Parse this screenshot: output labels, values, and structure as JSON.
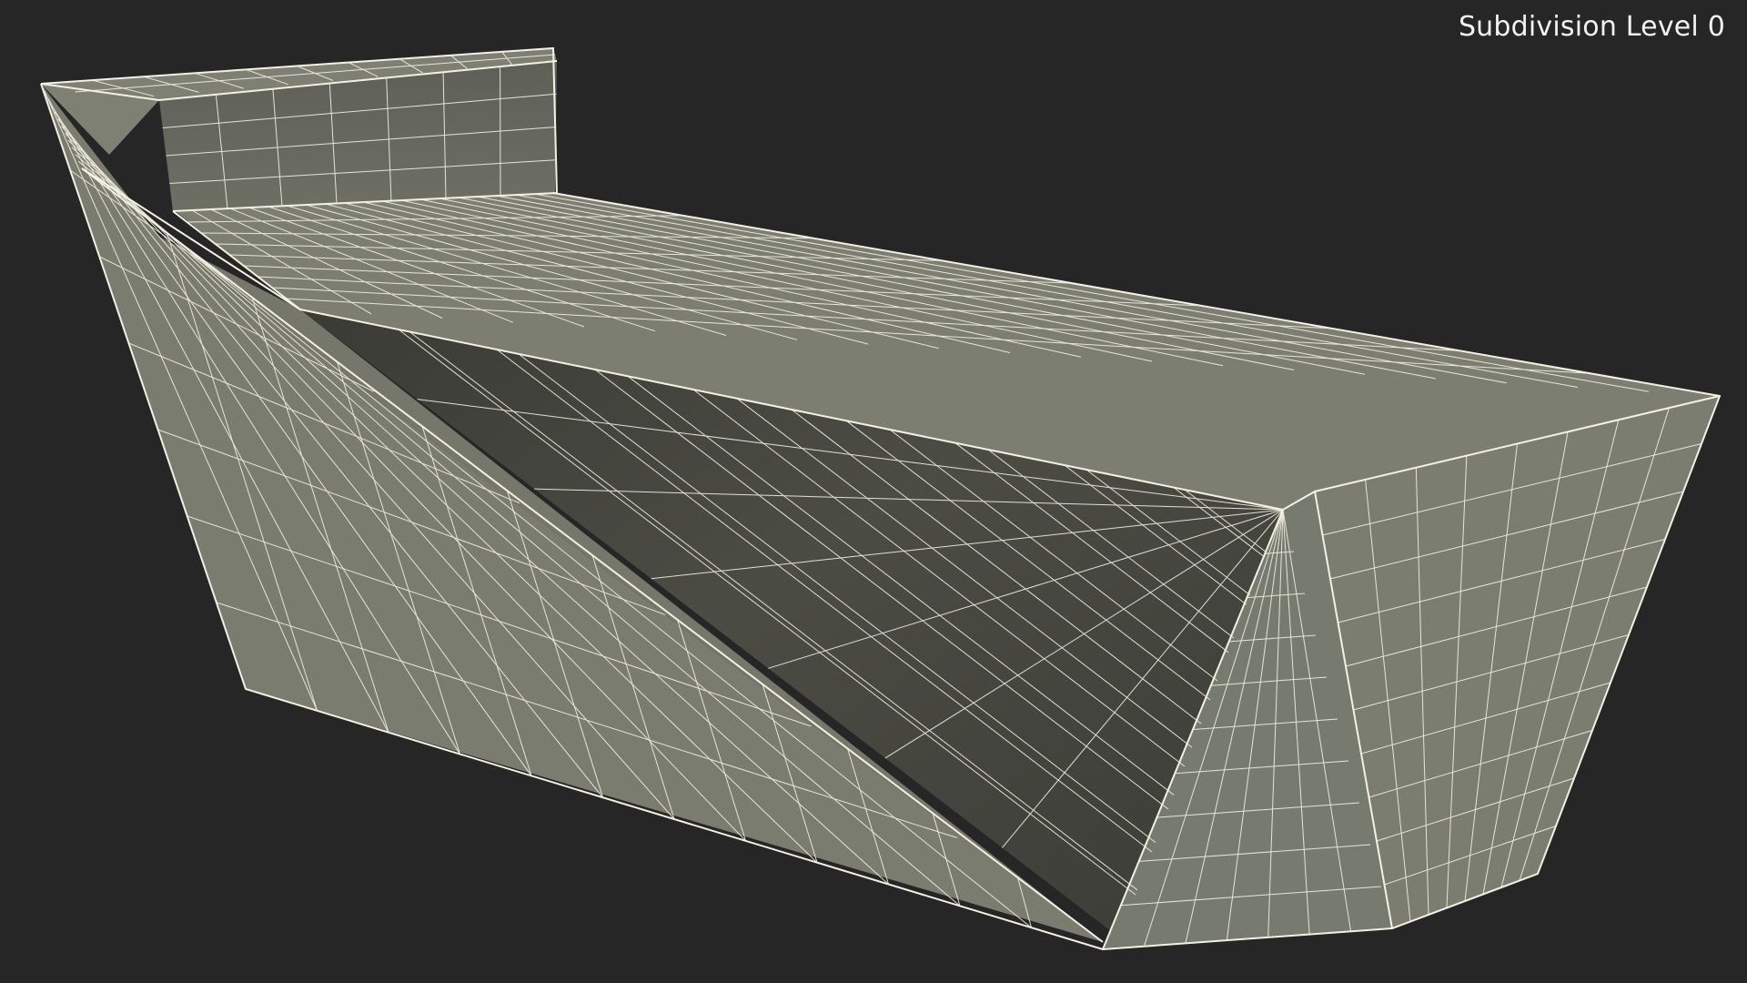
{
  "viewport": {
    "label": "Subdivision Level 0",
    "background_color": "#262626"
  },
  "model": {
    "description_icon": "wireframe-mesh-reception-desk",
    "face_color": "#787a6e",
    "face_color_light": "#7d7f73",
    "face_color_dark": "#4a4b43",
    "wire_color": "#f3f1e2"
  }
}
